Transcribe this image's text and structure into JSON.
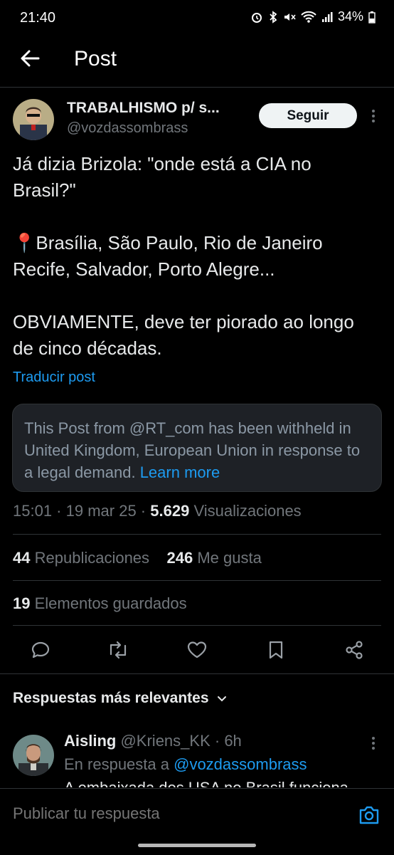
{
  "status_bar": {
    "time": "21:40",
    "battery": "34%"
  },
  "header": {
    "title": "Post"
  },
  "author": {
    "name": "TRABALHISMO p/ s...",
    "handle": "@vozdassombrass",
    "follow_label": "Seguir"
  },
  "post": {
    "text": "Já dizia Brizola: \"onde está a CIA no Brasil?\"\n\n📍Brasília, São Paulo, Rio de Janeiro Recife, Salvador, Porto Alegre...\n\nOBVIAMENTE, deve ter piorado ao longo de cinco décadas.",
    "translate_label": "Traducir post",
    "notice_text": "This Post from @RT_com has been withheld in United Kingdom, European Union in response to a legal demand.",
    "notice_link": "Learn more",
    "time": "15:01",
    "date": "19 mar 25",
    "views_count": "5.629",
    "views_label": "Visualizaciones",
    "reposts_count": "44",
    "reposts_label": "Republicaciones",
    "likes_count": "246",
    "likes_label": "Me gusta",
    "bookmarks_count": "19",
    "bookmarks_label": "Elementos guardados"
  },
  "replies": {
    "sort_label": "Respuestas más relevantes",
    "items": [
      {
        "name": "Aisling",
        "handle": "@Kriens_KK",
        "age": "6h",
        "in_reply_prefix": "En respuesta a",
        "in_reply_to": "@vozdassombrass",
        "text": "A embaixada dos USA no Brasil funciona"
      }
    ]
  },
  "composer": {
    "placeholder": "Publicar tu respuesta"
  },
  "colors": {
    "accent": "#1d9bf0",
    "background": "#000000",
    "muted": "#71767b"
  }
}
